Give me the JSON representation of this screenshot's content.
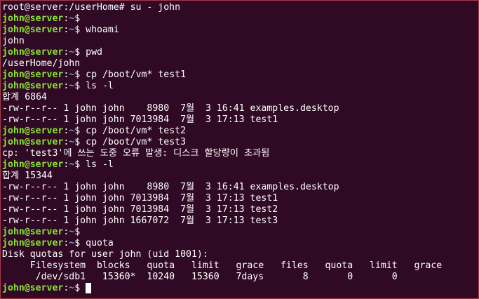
{
  "terminal": {
    "lines": [
      {
        "kind": "root_cmd",
        "text": "root@server:/userHome# su - john"
      },
      {
        "kind": "prompt",
        "user_host": "john@server",
        "path": "~",
        "sym": "$",
        "cmd": ""
      },
      {
        "kind": "prompt",
        "user_host": "john@server",
        "path": "~",
        "sym": "$",
        "cmd": " whoami"
      },
      {
        "kind": "output",
        "text": "john"
      },
      {
        "kind": "prompt",
        "user_host": "john@server",
        "path": "~",
        "sym": "$",
        "cmd": " pwd"
      },
      {
        "kind": "output",
        "text": "/userHome/john"
      },
      {
        "kind": "prompt",
        "user_host": "john@server",
        "path": "~",
        "sym": "$",
        "cmd": " cp /boot/vm* test1"
      },
      {
        "kind": "prompt",
        "user_host": "john@server",
        "path": "~",
        "sym": "$",
        "cmd": " ls -l"
      },
      {
        "kind": "output",
        "text": "합계 6864"
      },
      {
        "kind": "output",
        "text": "-rw-r--r-- 1 john john    8980  7월  3 16:41 examples.desktop"
      },
      {
        "kind": "output",
        "text": "-rw-r--r-- 1 john john 7013984  7월  3 17:13 test1"
      },
      {
        "kind": "prompt",
        "user_host": "john@server",
        "path": "~",
        "sym": "$",
        "cmd": " cp /boot/vm* test2"
      },
      {
        "kind": "prompt",
        "user_host": "john@server",
        "path": "~",
        "sym": "$",
        "cmd": " cp /boot/vm* test3"
      },
      {
        "kind": "output",
        "text": "cp: 'test3'에 쓰는 도중 오류 발생: 디스크 할당량이 초과됨"
      },
      {
        "kind": "prompt",
        "user_host": "john@server",
        "path": "~",
        "sym": "$",
        "cmd": " ls -l"
      },
      {
        "kind": "output",
        "text": "합계 15344"
      },
      {
        "kind": "output",
        "text": "-rw-r--r-- 1 john john    8980  7월  3 16:41 examples.desktop"
      },
      {
        "kind": "output",
        "text": "-rw-r--r-- 1 john john 7013984  7월  3 17:13 test1"
      },
      {
        "kind": "output",
        "text": "-rw-r--r-- 1 john john 7013984  7월  3 17:13 test2"
      },
      {
        "kind": "output",
        "text": "-rw-r--r-- 1 john john 1667072  7월  3 17:13 test3"
      },
      {
        "kind": "prompt",
        "user_host": "john@server",
        "path": "~",
        "sym": "$",
        "cmd": ""
      },
      {
        "kind": "prompt",
        "user_host": "john@server",
        "path": "~",
        "sym": "$",
        "cmd": " quota"
      },
      {
        "kind": "output",
        "text": "Disk quotas for user john (uid 1001):"
      },
      {
        "kind": "output",
        "text": "     Filesystem  blocks   quota   limit   grace   files   quota   limit   grace"
      },
      {
        "kind": "output",
        "text": "      /dev/sdb1   15360*  10240   15360   7days       8       0       0"
      },
      {
        "kind": "prompt_cursor",
        "user_host": "john@server",
        "path": "~",
        "sym": "$",
        "cmd": " "
      }
    ]
  },
  "colors": {
    "background": "#300a24",
    "prompt_user": "#8ae234",
    "prompt_path": "#729fcf",
    "text": "#ffffff"
  }
}
